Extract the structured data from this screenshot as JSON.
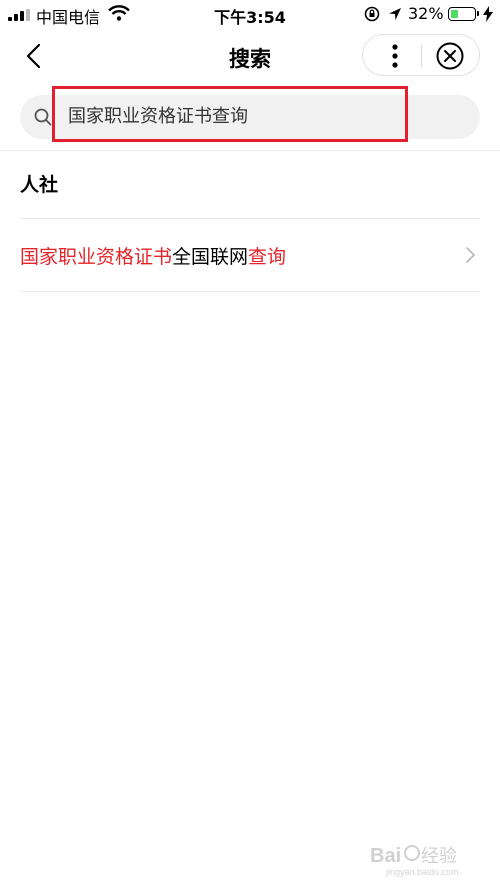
{
  "status_bar": {
    "carrier": "中国电信",
    "time": "下午3:54",
    "battery_percent": "32%",
    "battery_level": 0.32
  },
  "nav": {
    "title": "搜索"
  },
  "search": {
    "value": "国家职业资格证书查询"
  },
  "section": {
    "title": "人社"
  },
  "results": [
    {
      "part1": "国家职业资格证书",
      "part2": "全国联网",
      "part3": "查询"
    }
  ],
  "watermark": {
    "text": "Baidu经验",
    "url": "jingyan.baidu.com"
  },
  "colors": {
    "highlight": "#e5252a",
    "search_bg": "#f1f1f1",
    "box": "#e0202e"
  }
}
